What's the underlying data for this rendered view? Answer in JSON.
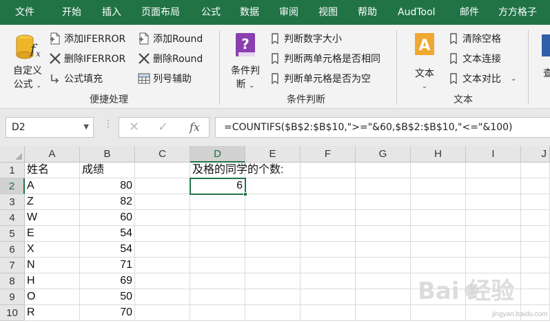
{
  "tabs": [
    "文件",
    "开始",
    "插入",
    "页面布局",
    "公式",
    "数据",
    "审阅",
    "视图",
    "帮助",
    "AudTool",
    "邮件",
    "方方格子"
  ],
  "ribbon": {
    "custom_formula": {
      "line1": "自定义",
      "line2": "公式"
    },
    "quick_group": {
      "add_iferror": "添加IFERROR",
      "add_round": "添加Round",
      "del_iferror": "删除IFERROR",
      "del_round": "删除Round",
      "formula_fill": "公式填充",
      "col_helper": "列号辅助",
      "label": "便捷处理"
    },
    "cond_group": {
      "big_line1": "条件判",
      "big_line2": "断",
      "judge_num": "判断数字大小",
      "judge_same": "判断两单元格是否相同",
      "judge_empty": "判断单元格是否为空",
      "label": "条件判断"
    },
    "text_group": {
      "big": "文本",
      "clear_space": "清除空格",
      "text_join": "文本连接",
      "text_compare": "文本对比",
      "label": "文本"
    },
    "extra": "查"
  },
  "formula_bar": {
    "name_box": "D2",
    "formula": "=COUNTIFS($B$2:$B$10,\">=\"&60,$B$2:$B$10,\"<=\"&100)",
    "fx": "fx"
  },
  "columns": [
    "A",
    "B",
    "C",
    "D",
    "E",
    "F",
    "G",
    "H",
    "I",
    "J"
  ],
  "rows": [
    "1",
    "2",
    "3",
    "4",
    "5",
    "6",
    "7",
    "8",
    "9",
    "10"
  ],
  "sheet": {
    "header_name": "姓名",
    "header_score": "成绩",
    "d1_label": "及格的同学的个数:",
    "d2_value": "6",
    "data": [
      {
        "name": "A",
        "score": "80"
      },
      {
        "name": "Z",
        "score": "82"
      },
      {
        "name": "W",
        "score": "60"
      },
      {
        "name": "E",
        "score": "54"
      },
      {
        "name": "X",
        "score": "54"
      },
      {
        "name": "N",
        "score": "71"
      },
      {
        "name": "H",
        "score": "69"
      },
      {
        "name": "O",
        "score": "50"
      },
      {
        "name": "R",
        "score": "70"
      }
    ]
  },
  "watermark": {
    "brand": "Bai 经验",
    "url": "jingyan.baidu.com"
  },
  "colors": {
    "accent": "#217346",
    "ribbon_bg": "#f3f3f3",
    "grid_line": "#dadada"
  }
}
